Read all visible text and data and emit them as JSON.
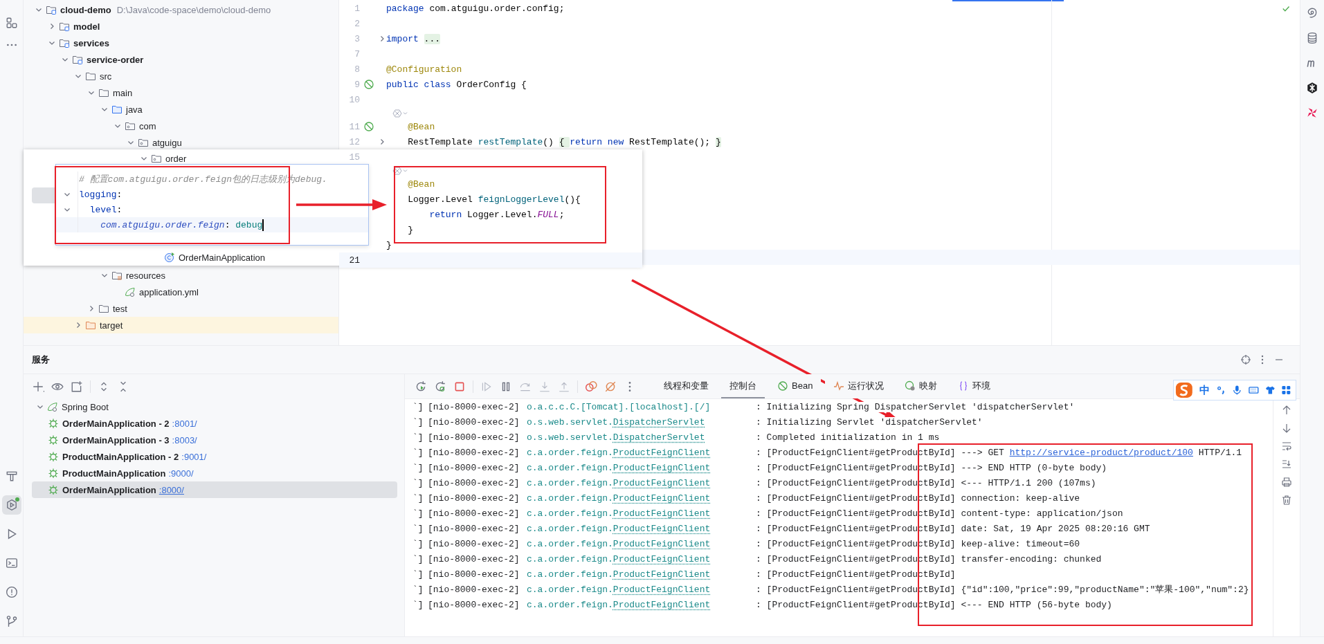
{
  "left_toolbar": {
    "bottom": [
      {
        "kind": "build",
        "selected": false,
        "running": false
      },
      {
        "kind": "services",
        "selected": true,
        "running": true
      },
      {
        "kind": "run",
        "selected": false,
        "running": false
      },
      {
        "kind": "terminal",
        "selected": false,
        "running": false
      },
      {
        "kind": "problems",
        "selected": false,
        "running": false
      },
      {
        "kind": "git",
        "selected": false,
        "running": false
      }
    ]
  },
  "project_tree": {
    "items": [
      {
        "label": "cloud-demo",
        "path": "D:\\Java\\code-space\\demo\\cloud-demo",
        "kind": "module",
        "expanded": true,
        "children": [
          {
            "label": "model",
            "kind": "module",
            "expanded": false
          },
          {
            "label": "services",
            "kind": "module",
            "expanded": true,
            "children": [
              {
                "label": "service-order",
                "kind": "module",
                "expanded": true,
                "children": [
                  {
                    "label": "src",
                    "kind": "folder",
                    "expanded": true,
                    "children": [
                      {
                        "label": "main",
                        "kind": "folder",
                        "expanded": true,
                        "children": [
                          {
                            "label": "java",
                            "kind": "source",
                            "expanded": true,
                            "children": [
                              {
                                "label": "com",
                                "kind": "package",
                                "expanded": true,
                                "children": [
                                  {
                                    "label": "atguigu",
                                    "kind": "package",
                                    "expanded": true
                                  }
                                ]
                              }
                            ]
                          },
                          {
                            "label": "resources",
                            "kind": "resources",
                            "expanded": true,
                            "children": [
                              {
                                "label": "application.yml",
                                "kind": "config"
                              }
                            ]
                          }
                        ]
                      },
                      {
                        "label": "test",
                        "kind": "folder",
                        "expanded": false
                      }
                    ]
                  },
                  {
                    "label": "target",
                    "kind": "excluded",
                    "expanded": false
                  }
                ]
              }
            ]
          }
        ]
      }
    ]
  },
  "editor": {
    "lines": [
      {
        "kind": "code",
        "number": "1",
        "folded": false,
        "bean_marker": false,
        "tokens": [
          {
            "text": "package ",
            "kind": "keyword"
          },
          {
            "text": "com.atguigu.order.config;",
            "kind": "plain"
          }
        ]
      },
      {
        "kind": "code",
        "number": "2",
        "folded": false,
        "bean_marker": false
      },
      {
        "kind": "code",
        "number": "3",
        "folded": true,
        "bean_marker": false,
        "tokens": [
          {
            "text": "import ",
            "kind": "keyword"
          },
          {
            "text": "...",
            "kind": "folded"
          }
        ]
      },
      {
        "kind": "code",
        "number": "7",
        "folded": false,
        "bean_marker": false
      },
      {
        "kind": "code",
        "number": "8",
        "folded": false,
        "bean_marker": false,
        "tokens": [
          {
            "text": "@Configuration",
            "kind": "annotation"
          }
        ]
      },
      {
        "kind": "code",
        "number": "9",
        "folded": false,
        "bean_marker": true,
        "tokens": [
          {
            "text": "public class ",
            "kind": "keyword"
          },
          {
            "text": "OrderConfig {",
            "kind": "plain"
          }
        ]
      },
      {
        "kind": "code",
        "number": "10",
        "folded": false,
        "bean_marker": false
      },
      {
        "kind": "hint"
      },
      {
        "kind": "code",
        "number": "11",
        "folded": false,
        "bean_marker": true,
        "tokens": [
          {
            "text": "    @Bean",
            "kind": "annotation"
          }
        ]
      },
      {
        "kind": "code",
        "number": "12",
        "folded": true,
        "bean_marker": false,
        "tokens": [
          {
            "text": "    RestTemplate ",
            "kind": "plain"
          },
          {
            "text": "restTemplate",
            "kind": "method"
          },
          {
            "text": "() ",
            "kind": "plain"
          },
          {
            "text": "{ ",
            "kind": "folded"
          },
          {
            "text": "return new ",
            "kind": "keyword"
          },
          {
            "text": "RestTemplate(); ",
            "kind": "plain"
          },
          {
            "text": "}",
            "kind": "folded"
          }
        ]
      }
    ]
  },
  "snippet": {
    "tree": [
      {
        "label": "order",
        "kind": "package",
        "expanded": true,
        "children": [
          {
            "label": "OrderMainApplication",
            "kind": "app"
          }
        ]
      }
    ],
    "lines": [
      {
        "kind": "code",
        "number": "15",
        "folded": false
      },
      {
        "kind": "hint"
      },
      {
        "kind": "code",
        "folded": false,
        "tokens": [
          {
            "text": "    @Bean",
            "kind": "annotation"
          }
        ]
      },
      {
        "kind": "code",
        "folded": false,
        "tokens": [
          {
            "text": "    Logger.Level ",
            "kind": "plain"
          },
          {
            "text": "feignLoggerLevel",
            "kind": "method"
          },
          {
            "text": "(){",
            "kind": "plain"
          }
        ]
      },
      {
        "kind": "code",
        "folded": false,
        "tokens": [
          {
            "text": "        return ",
            "kind": "keyword"
          },
          {
            "text": "Logger.Level.",
            "kind": "plain"
          },
          {
            "text": "FULL",
            "kind": "constant"
          },
          {
            "text": ";",
            "kind": "plain"
          }
        ]
      },
      {
        "kind": "code",
        "folded": false,
        "tokens": [
          {
            "text": "    }",
            "kind": "plain"
          }
        ]
      },
      {
        "kind": "code",
        "folded": false,
        "tokens": [
          {
            "text": "}",
            "kind": "plain"
          }
        ]
      },
      {
        "kind": "code",
        "number": "21",
        "folded": false,
        "current": true
      }
    ]
  },
  "yaml_popup": {
    "lines": [
      {
        "folded": false,
        "current": false,
        "tokens": [
          {
            "text": "# 配置com.atguigu.order.feign包的日志级别为debug.",
            "kind": "comment"
          }
        ]
      },
      {
        "folded": true,
        "current": false,
        "tokens": [
          {
            "text": "logging",
            "kind": "key"
          },
          {
            "text": ":",
            "kind": "plain"
          }
        ]
      },
      {
        "folded": true,
        "current": false,
        "tokens": [
          {
            "text": "  level",
            "kind": "key"
          },
          {
            "text": ":",
            "kind": "plain"
          }
        ]
      },
      {
        "folded": false,
        "current": true,
        "tokens": [
          {
            "text": "    com.atguigu.order.feign",
            "kind": "package_key"
          },
          {
            "text": ": ",
            "kind": "plain"
          },
          {
            "text": "debug",
            "kind": "value"
          }
        ]
      }
    ]
  },
  "services": {
    "title": "服务",
    "groups": [
      {
        "label": "Spring Boot",
        "expanded": true,
        "children": [
          {
            "name": "OrderMainApplication - 2",
            "port": ":8001/",
            "selected": false
          },
          {
            "name": "OrderMainApplication - 3",
            "port": ":8003/",
            "selected": false
          },
          {
            "name": "ProductMainApplication - 2",
            "port": ":9001/",
            "selected": false
          },
          {
            "name": "ProductMainApplication",
            "port": ":9000/",
            "selected": false
          },
          {
            "name": "OrderMainApplication",
            "port": ":8000/",
            "selected": true
          }
        ]
      }
    ],
    "tabs": [
      {
        "label": "线程和变量",
        "kind": "threads",
        "selected": false
      },
      {
        "label": "控制台",
        "kind": "console",
        "selected": true
      },
      {
        "label": "Bean",
        "kind": "beans",
        "selected": false
      },
      {
        "label": "运行状况",
        "kind": "health",
        "selected": false
      },
      {
        "label": "映射",
        "kind": "mappings",
        "selected": false
      },
      {
        "label": "环境",
        "kind": "environment",
        "selected": false
      }
    ],
    "log": [
      {
        "lead": "`]",
        "thread": "[nio-8000-exec-2]",
        "logger": "o.a.c.c.C.[Tomcat].[localhost].[/]",
        "message": ": Initializing Spring DispatcherServlet 'dispatcherServlet'"
      },
      {
        "lead": "`]",
        "thread": "[nio-8000-exec-2]",
        "logger": "o.s.web.servlet.",
        "logger_class": "DispatcherServlet",
        "message": ": Initializing Servlet 'dispatcherServlet'"
      },
      {
        "lead": "`]",
        "thread": "[nio-8000-exec-2]",
        "logger": "o.s.web.servlet.",
        "logger_class": "DispatcherServlet",
        "message": ": Completed initialization in 1 ms"
      },
      {
        "lead": "`]",
        "thread": "[nio-8000-exec-2]",
        "logger": "c.a.order.feign.",
        "logger_class": "ProductFeignClient",
        "message": ": [ProductFeignClient#getProductById] ---> GET ",
        "link": "http://service-product/product/100",
        "message_end": " HTTP/1.1"
      },
      {
        "lead": "`]",
        "thread": "[nio-8000-exec-2]",
        "logger": "c.a.order.feign.",
        "logger_class": "ProductFeignClient",
        "message": ": [ProductFeignClient#getProductById] ---> END HTTP (0-byte body)"
      },
      {
        "lead": "`]",
        "thread": "[nio-8000-exec-2]",
        "logger": "c.a.order.feign.",
        "logger_class": "ProductFeignClient",
        "message": ": [ProductFeignClient#getProductById] <--- HTTP/1.1 200 (107ms)"
      },
      {
        "lead": "`]",
        "thread": "[nio-8000-exec-2]",
        "logger": "c.a.order.feign.",
        "logger_class": "ProductFeignClient",
        "message": ": [ProductFeignClient#getProductById] connection: keep-alive"
      },
      {
        "lead": "`]",
        "thread": "[nio-8000-exec-2]",
        "logger": "c.a.order.feign.",
        "logger_class": "ProductFeignClient",
        "message": ": [ProductFeignClient#getProductById] content-type: application/json"
      },
      {
        "lead": "`]",
        "thread": "[nio-8000-exec-2]",
        "logger": "c.a.order.feign.",
        "logger_class": "ProductFeignClient",
        "message": ": [ProductFeignClient#getProductById] date: Sat, 19 Apr 2025 08:20:16 GMT"
      },
      {
        "lead": "`]",
        "thread": "[nio-8000-exec-2]",
        "logger": "c.a.order.feign.",
        "logger_class": "ProductFeignClient",
        "message": ": [ProductFeignClient#getProductById] keep-alive: timeout=60"
      },
      {
        "lead": "`]",
        "thread": "[nio-8000-exec-2]",
        "logger": "c.a.order.feign.",
        "logger_class": "ProductFeignClient",
        "message": ": [ProductFeignClient#getProductById] transfer-encoding: chunked"
      },
      {
        "lead": "`]",
        "thread": "[nio-8000-exec-2]",
        "logger": "c.a.order.feign.",
        "logger_class": "ProductFeignClient",
        "message": ": [ProductFeignClient#getProductById]"
      },
      {
        "lead": "`]",
        "thread": "[nio-8000-exec-2]",
        "logger": "c.a.order.feign.",
        "logger_class": "ProductFeignClient",
        "message": ": [ProductFeignClient#getProductById] {\"id\":100,\"price\":99,\"productName\":\"苹果-100\",\"num\":2}"
      },
      {
        "lead": "`]",
        "thread": "[nio-8000-exec-2]",
        "logger": "c.a.order.feign.",
        "logger_class": "ProductFeignClient",
        "message": ": [ProductFeignClient#getProductById] <--- END HTTP (56-byte body)"
      }
    ]
  },
  "ime_bar": {
    "mode": "中"
  }
}
